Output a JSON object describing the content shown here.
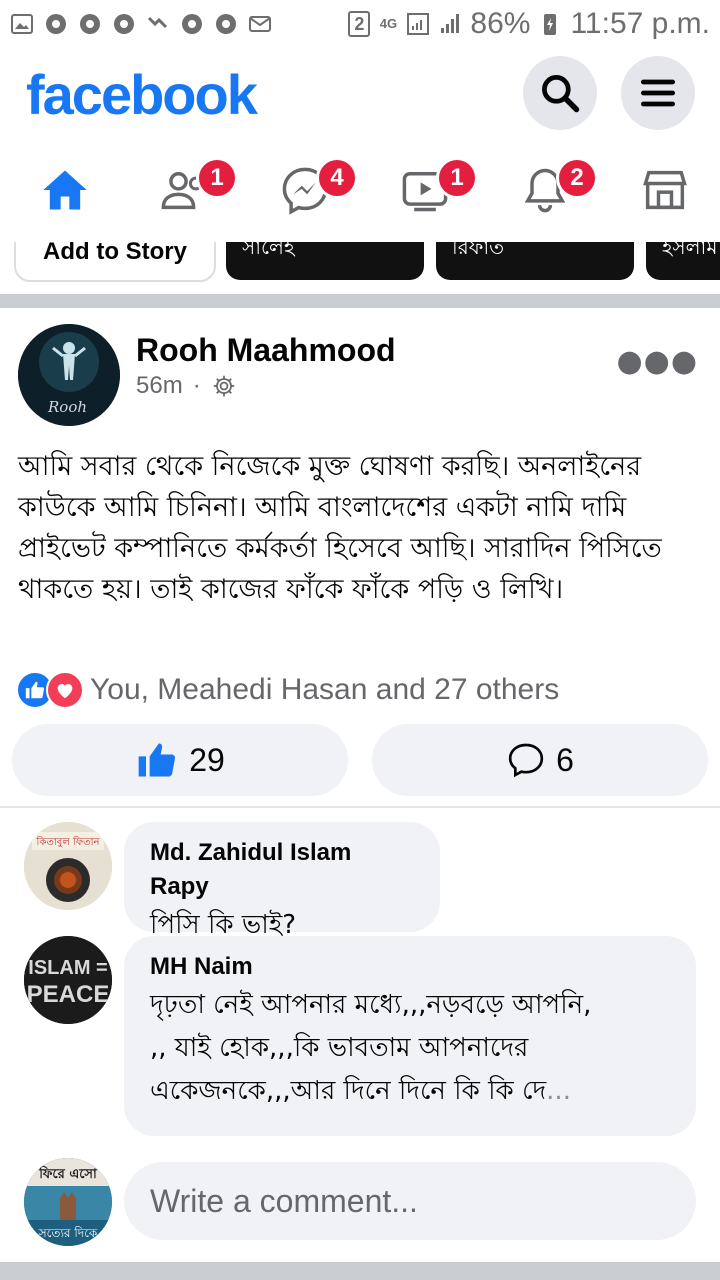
{
  "status_bar": {
    "battery": "86%",
    "time": "11:57 p.m.",
    "sim": "2",
    "network": "4G"
  },
  "header": {
    "logo": "facebook",
    "search_icon": "search-icon",
    "menu_icon": "menu-icon"
  },
  "nav": {
    "tabs": [
      {
        "name": "home",
        "icon": "home-icon",
        "active": true,
        "badge": ""
      },
      {
        "name": "friends",
        "icon": "friends-icon",
        "active": false,
        "badge": "1"
      },
      {
        "name": "messenger",
        "icon": "messenger-icon",
        "active": false,
        "badge": "4"
      },
      {
        "name": "watch",
        "icon": "video-icon",
        "active": false,
        "badge": "1"
      },
      {
        "name": "notifications",
        "icon": "bell-icon",
        "active": false,
        "badge": "2"
      },
      {
        "name": "marketplace",
        "icon": "store-icon",
        "active": false,
        "badge": ""
      }
    ]
  },
  "stories": {
    "add_label": "Add to Story",
    "cards": [
      "সালেহ",
      "রিফাত",
      "ইসলাম"
    ]
  },
  "post": {
    "author": "Rooh Maahmood",
    "time": "56m",
    "text": "আমি সবার থেকে নিজেকে মুক্ত ঘোষণা করছি। অনলাইনের কাউকে আমি চিনিনা। আমি বাংলাদেশের একটা নামি দামি  প্রাইভেট কম্পানিতে কর্মকর্তা হিসেবে আছি। সারাদিন পিসিতে থাকতে হয়। তাই কাজের ফাঁকে ফাঁকে পড়ি ও লিখি।",
    "reactions_text": "You, Meahedi Hasan and 27 others",
    "like_count": "29",
    "comment_count": "6"
  },
  "comments": [
    {
      "name": "Md. Zahidul Islam Rapy",
      "text": "পিসি কি ভাই?"
    },
    {
      "name": "MH Naim",
      "line1": "দৃঢ়তা নেই আপনার মধ্যে,,,নড়বড়ে আপনি,",
      "line2": ",, যাই হোক,,,কি ভাবতাম আপনাদের",
      "line3": "একেজনকে,,,আর দিনে দিনে কি কি দে",
      "more": "..."
    }
  ],
  "avatar_texts": {
    "commenter1": "কিতাবুল ফিতান",
    "commenter2_top": "ISLAM =",
    "commenter2_bottom": "PEACE",
    "self_top": "ফিরে এসো",
    "self_bottom": "সত্যের দিকে"
  },
  "write_comment_placeholder": "Write a comment..."
}
